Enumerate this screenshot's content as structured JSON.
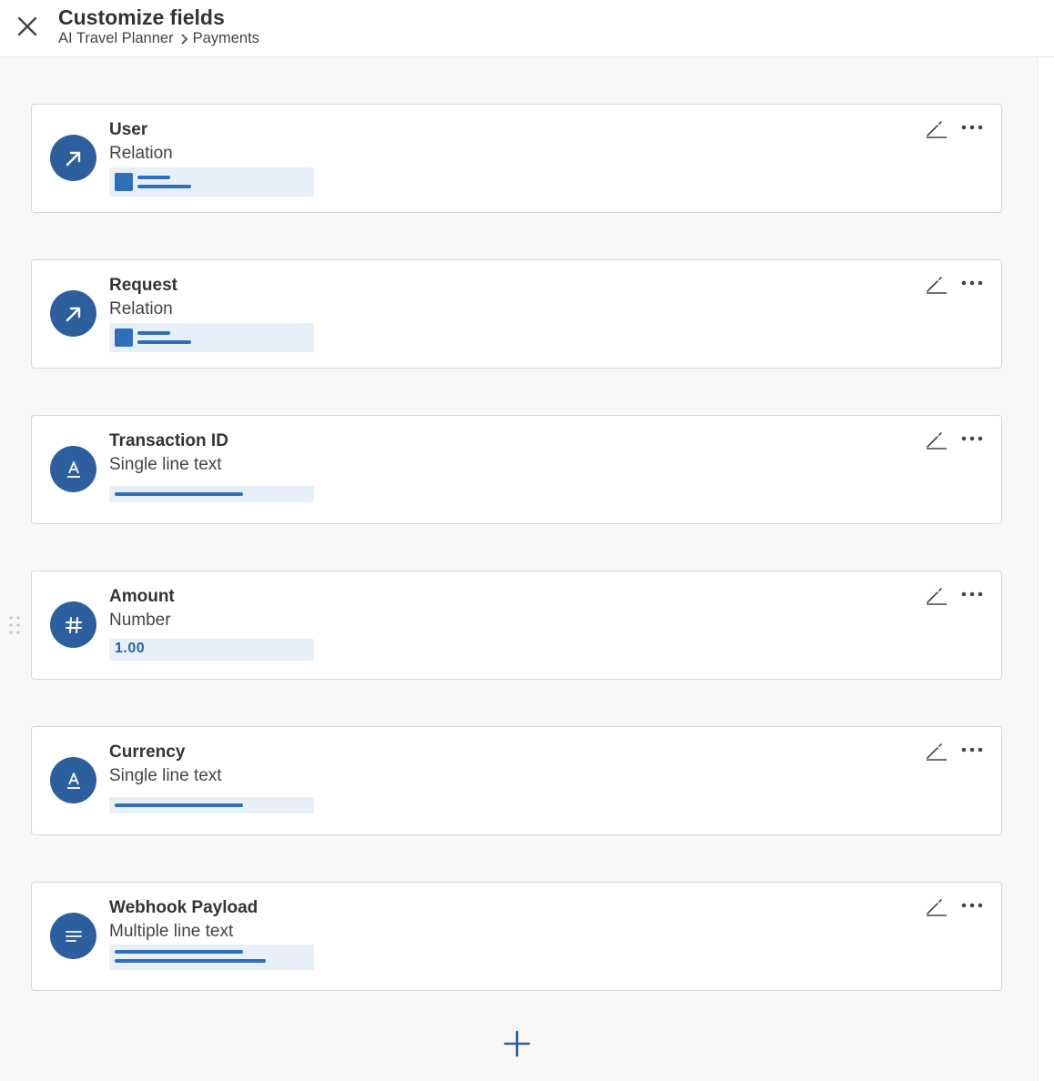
{
  "header": {
    "title": "Customize fields",
    "breadcrumb": [
      "AI Travel Planner",
      "Payments"
    ]
  },
  "fields": [
    {
      "name": "User",
      "type": "Relation",
      "icon": "arrow-up-right-icon",
      "preview": "relation"
    },
    {
      "name": "Request",
      "type": "Relation",
      "icon": "arrow-up-right-icon",
      "preview": "relation"
    },
    {
      "name": "Transaction ID",
      "type": "Single line text",
      "icon": "text-a-icon",
      "preview": "single-line"
    },
    {
      "name": "Amount",
      "type": "Number",
      "icon": "hash-icon",
      "preview": "number",
      "preview_value": "1.00"
    },
    {
      "name": "Currency",
      "type": "Single line text",
      "icon": "text-a-icon",
      "preview": "single-line"
    },
    {
      "name": "Webhook Payload",
      "type": "Multiple line text",
      "icon": "paragraph-lines-icon",
      "preview": "multi-line"
    }
  ],
  "colors": {
    "accent": "#2d5f9e",
    "preview_bg": "#e7f0f8",
    "preview_fg": "#2f6fba",
    "canvas_bg": "#f7f7f6"
  }
}
